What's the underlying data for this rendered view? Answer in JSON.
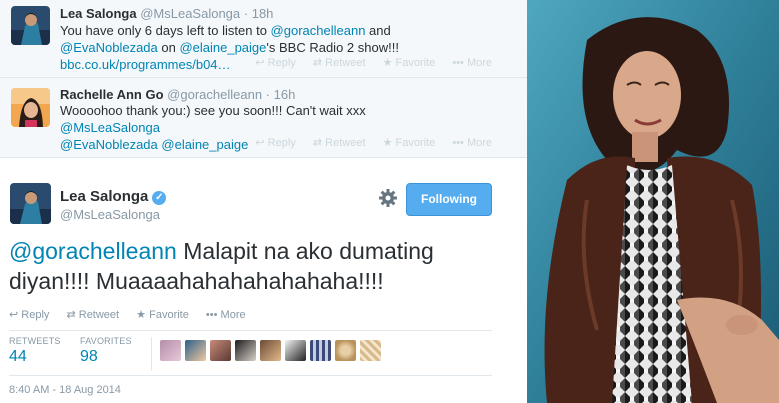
{
  "tweet1": {
    "name": "Lea Salonga",
    "handle": "@MsLeaSalonga",
    "time": "18h",
    "text_pre": "You have only 6 days left to listen to ",
    "mention1": "@gorachelleann",
    "text_mid": " and ",
    "mention2": "@EvaNoblezada",
    "text_mid2": " on ",
    "mention3": "@elaine_paige",
    "text_post": "'s BBC Radio 2 show!!! ",
    "link": "bbc.co.uk/programmes/b04…",
    "actions": {
      "reply": "Reply",
      "retweet": "Retweet",
      "favorite": "Favorite",
      "more": "More"
    }
  },
  "tweet2": {
    "name": "Rachelle Ann Go",
    "handle": "@gorachelleann",
    "time": "16h",
    "text_pre": "Woooohoo thank you:) see you soon!!! Can't wait xxx ",
    "mention1": "@MsLeaSalonga",
    "mention2": "@EvaNoblezada",
    "mention3": "@elaine_paige",
    "actions": {
      "reply": "Reply",
      "retweet": "Retweet",
      "favorite": "Favorite",
      "more": "More"
    }
  },
  "main": {
    "name": "Lea Salonga",
    "handle": "@MsLeaSalonga",
    "follow_label": "Following",
    "mention": "@gorachelleann",
    "text": " Malapit na ako dumating diyan!!!! Muaaaahahahahahahaha!!!!",
    "actions": {
      "reply": "Reply",
      "retweet": "Retweet",
      "favorite": "Favorite",
      "more": "More"
    },
    "retweets_label": "RETWEETS",
    "retweets_value": "44",
    "favorites_label": "FAVORITES",
    "favorites_value": "98",
    "timestamp": "8:40 AM - 18 Aug 2014"
  },
  "colors": {
    "link": "#0084b4",
    "button": "#55acee",
    "muted": "#8899a6"
  }
}
